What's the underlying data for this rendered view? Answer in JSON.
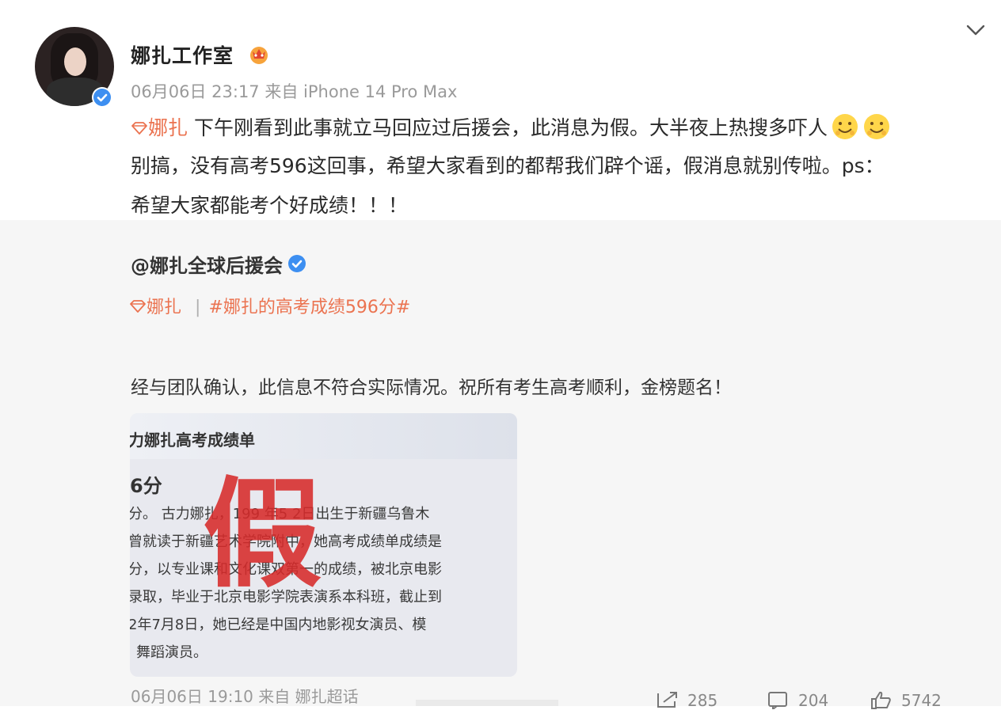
{
  "author": {
    "name": "娜扎工作室",
    "date": "06月06日",
    "time": "23:17",
    "source_prefix": "来自",
    "source": "iPhone 14 Pro Max"
  },
  "post": {
    "super_topic": "娜扎",
    "line1": " 下午刚看到此事就立马回应过后援会，此消息为假。大半夜上热搜多吓人",
    "line2": "别搞，没有高考596这回事，希望大家看到的都帮我们辟个谣，假消息就别传啦。ps：",
    "line3": "希望大家都能考个好成绩！！！"
  },
  "repost": {
    "author": "@娜扎全球后援会",
    "super_topic": "娜扎",
    "separator": "|",
    "hashtag": "#娜扎的高考成绩596分#",
    "body": "经与团队确认，此信息不符合实际情况。祝所有考生高考顺利，金榜题名！",
    "image": {
      "title": "力娜扎高考成绩单",
      "score": "6分",
      "lines": [
        "分。 古力娜扎，199 年5 2日出生于新疆乌鲁木",
        "曾就读于新疆艺术学院附中，她高考成绩单成绩是",
        "分，以专业课和文化课双第一的成绩，被北京电影",
        "录取，毕业于北京电影学院表演系本科班，截止到",
        "2年7月8日，她已经是中国内地影视女演员、模",
        "舞蹈演员。"
      ],
      "stamp": "假"
    },
    "date": "06月06日",
    "time": "19:10",
    "source_prefix": "来自",
    "source": "娜扎超话"
  },
  "stats": {
    "reposts": "285",
    "comments": "204",
    "likes": "5742"
  },
  "colors": {
    "accent": "#eb7350",
    "verified": "#3d8ff1",
    "meta": "#9a9a9a"
  }
}
